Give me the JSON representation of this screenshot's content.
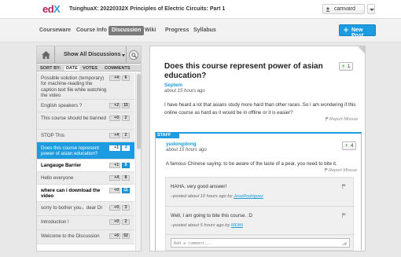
{
  "header": {
    "logo": {
      "e": "ed",
      "x": "X"
    },
    "course_title": "TsinghuaX: 20220332X Principles of Electric Circuits: Part 1",
    "username": "camvard"
  },
  "nav": {
    "tabs": [
      "Courseware",
      "Course Info",
      "Discussion",
      "Wiki",
      "Progress",
      "Syllabus"
    ],
    "active_tab": "Discussion",
    "new_post": "New Post"
  },
  "sidebar": {
    "filter_label": "Show All Discussions",
    "sort_label": "SORT BY:",
    "sort_options": [
      "DATE",
      "VOTES",
      "COMMENTS"
    ],
    "active_sort": "DATE",
    "posts": [
      {
        "title": "Possible solution (temporary) for machine-reading the caption text file while watching the video",
        "votes": "4",
        "comments": "6",
        "state": "read"
      },
      {
        "title": "English speakers ?",
        "votes": "2",
        "comments": "15",
        "state": "read"
      },
      {
        "title": "This course should be banned",
        "votes": "0",
        "comments": "2",
        "state": "read"
      },
      {
        "title": "STOP This",
        "votes": "4",
        "comments": "2",
        "state": "read"
      },
      {
        "title": "Does this course represent power of asian education?",
        "votes": "1",
        "comments": "4",
        "state": "selected"
      },
      {
        "title": "Langauge Barrier",
        "votes": "1",
        "comments": "9",
        "state": "unread"
      },
      {
        "title": "Hello everyone",
        "votes": "4",
        "comments": "8",
        "state": "read"
      },
      {
        "title": "where can i download the video",
        "votes": "0",
        "comments": "11",
        "state": "unread"
      },
      {
        "title": "sorry to bother you，dear Dr",
        "votes": "0",
        "comments": "3",
        "state": "read"
      },
      {
        "title": "Introduction !",
        "votes": "0",
        "comments": "2",
        "state": "read"
      },
      {
        "title": "Welcome to the Discussion",
        "votes": "6",
        "comments": "52",
        "state": "read"
      }
    ]
  },
  "thread": {
    "title": "Does this course represent power of asian education?",
    "votes": "1",
    "author": "Septem",
    "time": "about 15 hours ago",
    "body": "I have heard a lot that asians study more hard than other races. So I am wondering if this online course as hard as it would be in offline or it is easier?",
    "report": "Report Misuse"
  },
  "response": {
    "staff_tag": "STAFF",
    "author": "yudongdong",
    "time": "about 15 hours ago",
    "votes": "4",
    "body": "A famous Chinese saying: to be aware of the taste of a pear, you need to bite it.",
    "report": "Report Misuse",
    "comments": [
      {
        "text": "HAHA, very good answer!",
        "posted": "–posted about 10 hours ago by",
        "user": "JoseRodriguez"
      },
      {
        "text": "Well, I am going to bite this course. :D",
        "posted": "–posted about 5 hours ago by",
        "user": "MD89"
      }
    ],
    "add_comment_placeholder": "Add a comment..."
  },
  "colors": {
    "accent": "#1d9be0",
    "brand": "#b5225e",
    "vote_plus": "#4a9b31"
  },
  "icons": [
    "home-icon",
    "search-icon",
    "user-icon",
    "plus-icon",
    "flag-icon",
    "chevron-down-icon"
  ]
}
